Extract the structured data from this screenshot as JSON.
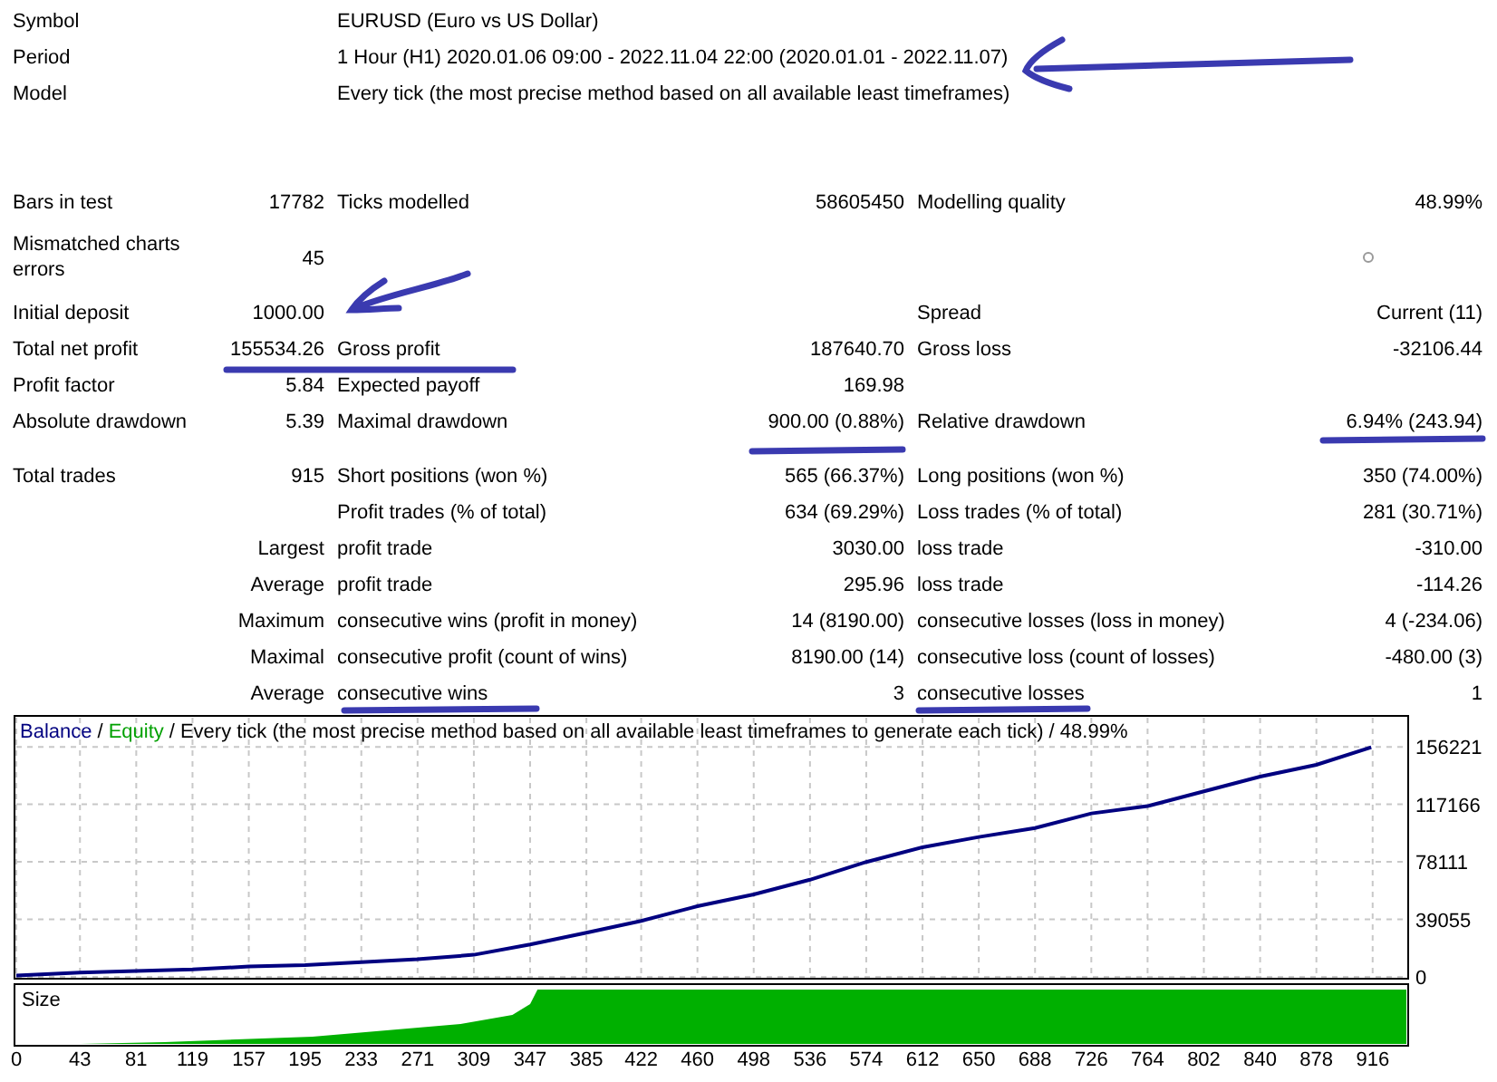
{
  "header": [
    {
      "label": "Symbol",
      "value": "EURUSD (Euro vs US Dollar)"
    },
    {
      "label": "Period",
      "value": "1 Hour (H1) 2020.01.06 09:00 - 2022.11.04 22:00 (2020.01.01 - 2022.11.07)"
    },
    {
      "label": "Model",
      "value": "Every tick (the most precise method based on all available least timeframes)"
    }
  ],
  "stat_groups": [
    [
      {
        "kind": "main",
        "label_1": "Bars in test",
        "value_1": "17782",
        "label_2": "Ticks modelled",
        "value_2": "58605450",
        "label_3": "Modelling quality",
        "value_3": "48.99%"
      },
      {
        "kind": "main",
        "label_1": "Mismatched charts errors",
        "value_1": "45"
      },
      {
        "kind": "main",
        "label_1": "Initial deposit",
        "value_1": "1000.00",
        "label_3": "Spread",
        "value_3": "Current (11)"
      },
      {
        "kind": "main",
        "label_1": "Total net profit",
        "value_1": "155534.26",
        "label_2": "Gross profit",
        "value_2": "187640.70",
        "label_3": "Gross loss",
        "value_3": "-32106.44"
      },
      {
        "kind": "main",
        "label_1": "Profit factor",
        "value_1": "5.84",
        "label_2": "Expected payoff",
        "value_2": "169.98"
      },
      {
        "kind": "main",
        "label_1": "Absolute drawdown",
        "value_1": "5.39",
        "label_2": "Maximal drawdown",
        "value_2": "900.00 (0.88%)",
        "label_3": "Relative drawdown",
        "value_3": "6.94% (243.94)"
      }
    ],
    [
      {
        "kind": "main",
        "label_1": "Total trades",
        "value_1": "915",
        "label_2": "Short positions (won %)",
        "value_2": "565 (66.37%)",
        "label_3": "Long positions (won %)",
        "value_3": "350 (74.00%)"
      },
      {
        "kind": "main",
        "label_2": "Profit trades (% of total)",
        "value_2": "634 (69.29%)",
        "label_3": "Loss trades (% of total)",
        "value_3": "281 (30.71%)"
      },
      {
        "kind": "sub",
        "label_1": "Largest",
        "label_2": "profit trade",
        "value_2": "3030.00",
        "label_3": "loss trade",
        "value_3": "-310.00"
      },
      {
        "kind": "sub",
        "label_1": "Average",
        "label_2": "profit trade",
        "value_2": "295.96",
        "label_3": "loss trade",
        "value_3": "-114.26"
      },
      {
        "kind": "sub",
        "label_1": "Maximum",
        "label_2": "consecutive wins (profit in money)",
        "value_2": "14 (8190.00)",
        "label_3": "consecutive losses (loss in money)",
        "value_3": "4 (-234.06)"
      },
      {
        "kind": "sub",
        "label_1": "Maximal",
        "label_2": "consecutive profit (count of wins)",
        "value_2": "8190.00 (14)",
        "label_3": "consecutive loss (count of losses)",
        "value_3": "-480.00 (3)"
      },
      {
        "kind": "sub",
        "label_1": "Average",
        "label_2": "consecutive wins",
        "value_2": "3",
        "label_3": "consecutive losses",
        "value_3": "1"
      }
    ]
  ],
  "chart": {
    "legend_separators": [
      "/",
      "/"
    ],
    "chart_data": {
      "type": "line",
      "title": "Every tick (the most precise method based on all available least timeframes to generate each tick) / 48.99%",
      "x": [
        0,
        43,
        81,
        119,
        157,
        195,
        233,
        271,
        309,
        347,
        385,
        422,
        460,
        498,
        536,
        574,
        612,
        650,
        688,
        726,
        764,
        802,
        840,
        878,
        915
      ],
      "series": [
        {
          "name": "Balance",
          "color": "#000080",
          "values": [
            1000,
            3000,
            4000,
            5000,
            7000,
            8000,
            10000,
            12000,
            15000,
            22000,
            30000,
            38000,
            48000,
            56000,
            66000,
            78000,
            88000,
            95000,
            101000,
            111000,
            116000,
            126000,
            136000,
            144000,
            156000
          ]
        },
        {
          "name": "Equity",
          "color": "#00a000",
          "values": [
            null,
            null,
            null,
            null,
            null,
            null,
            null,
            null,
            null,
            null,
            null,
            null,
            null,
            null,
            null,
            null,
            null,
            null,
            null,
            null,
            null,
            null,
            null,
            null,
            null
          ]
        }
      ],
      "xlim": [
        0,
        940
      ],
      "ylim": [
        0,
        176000
      ],
      "grid": true,
      "xticks": [
        0,
        43,
        81,
        119,
        157,
        195,
        233,
        271,
        309,
        347,
        385,
        422,
        460,
        498,
        536,
        574,
        612,
        650,
        688,
        726,
        764,
        802,
        840,
        878,
        916
      ],
      "yticks": [
        0,
        39055,
        78111,
        117166,
        156221
      ]
    },
    "size_panel": {
      "label": "Size"
    }
  }
}
